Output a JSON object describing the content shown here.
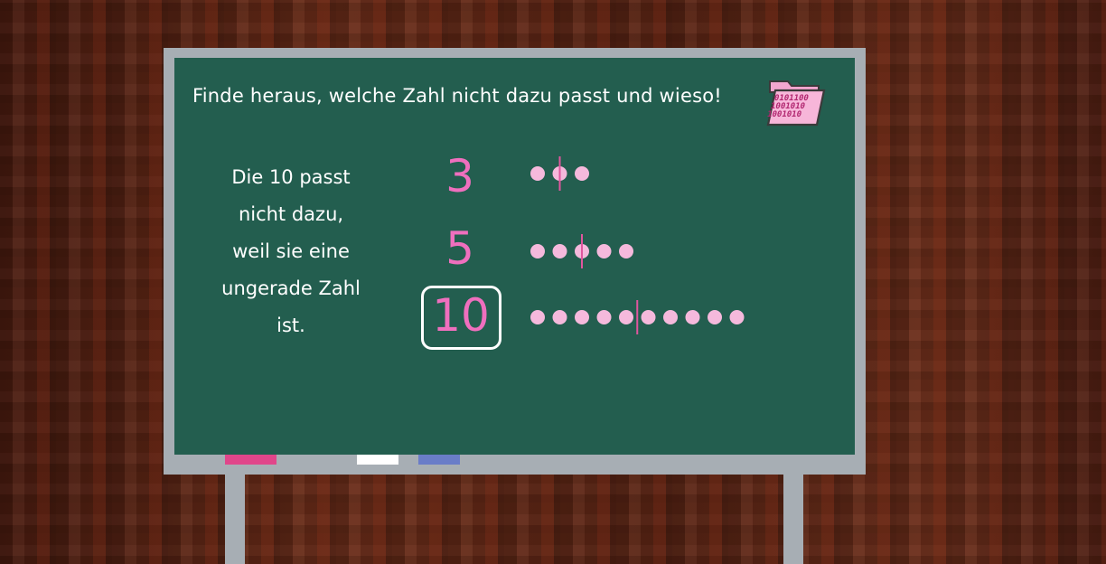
{
  "task": {
    "title": "Finde heraus, welche Zahl nicht dazu passt und wieso!"
  },
  "explanation_lines": [
    "Die 10 passt",
    "nicht dazu,",
    "weil sie eine",
    "ungerade Zahl",
    "ist."
  ],
  "numbers": [
    {
      "value": "3",
      "dots": 3,
      "selected": false
    },
    {
      "value": "5",
      "dots": 5,
      "selected": false
    },
    {
      "value": "10",
      "dots": 10,
      "selected": true
    }
  ],
  "folder_icon": {
    "binary_lines": [
      "0101100",
      "1001010",
      "1001010"
    ]
  },
  "icons": {
    "folder": "binary-folder-icon"
  },
  "colors": {
    "board": "#235e4f",
    "frame": "#a7aeb4",
    "number": "#ef6fbe",
    "dot": "#f5b9dc",
    "divider": "#e0569e",
    "chalk_pink": "#e0468a",
    "chalk_white": "#ffffff",
    "chalk_blue": "#6a7dc8"
  }
}
